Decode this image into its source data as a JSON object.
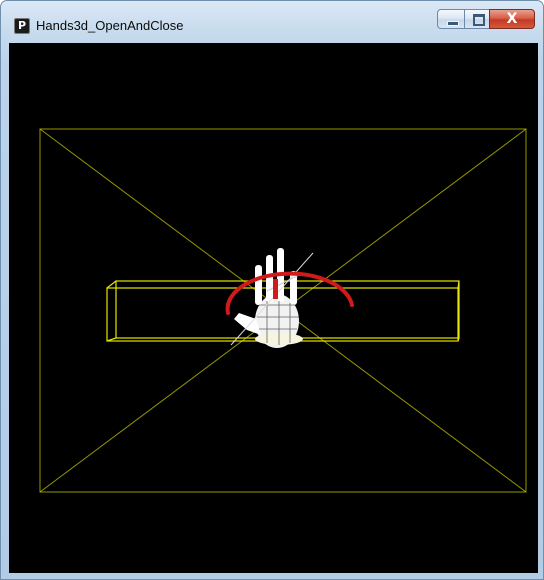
{
  "window": {
    "title": "Hands3d_OpenAndClose",
    "icon": "processing-app-icon",
    "icon_glyph": "P",
    "buttons": {
      "minimize": "",
      "maximize": "",
      "close": "X"
    }
  },
  "scene": {
    "background": "#000000",
    "room_color": "#c8c800",
    "box_color": "#e6e600",
    "hand_color": "#ffffff",
    "arc_color": "#d11a1a"
  }
}
